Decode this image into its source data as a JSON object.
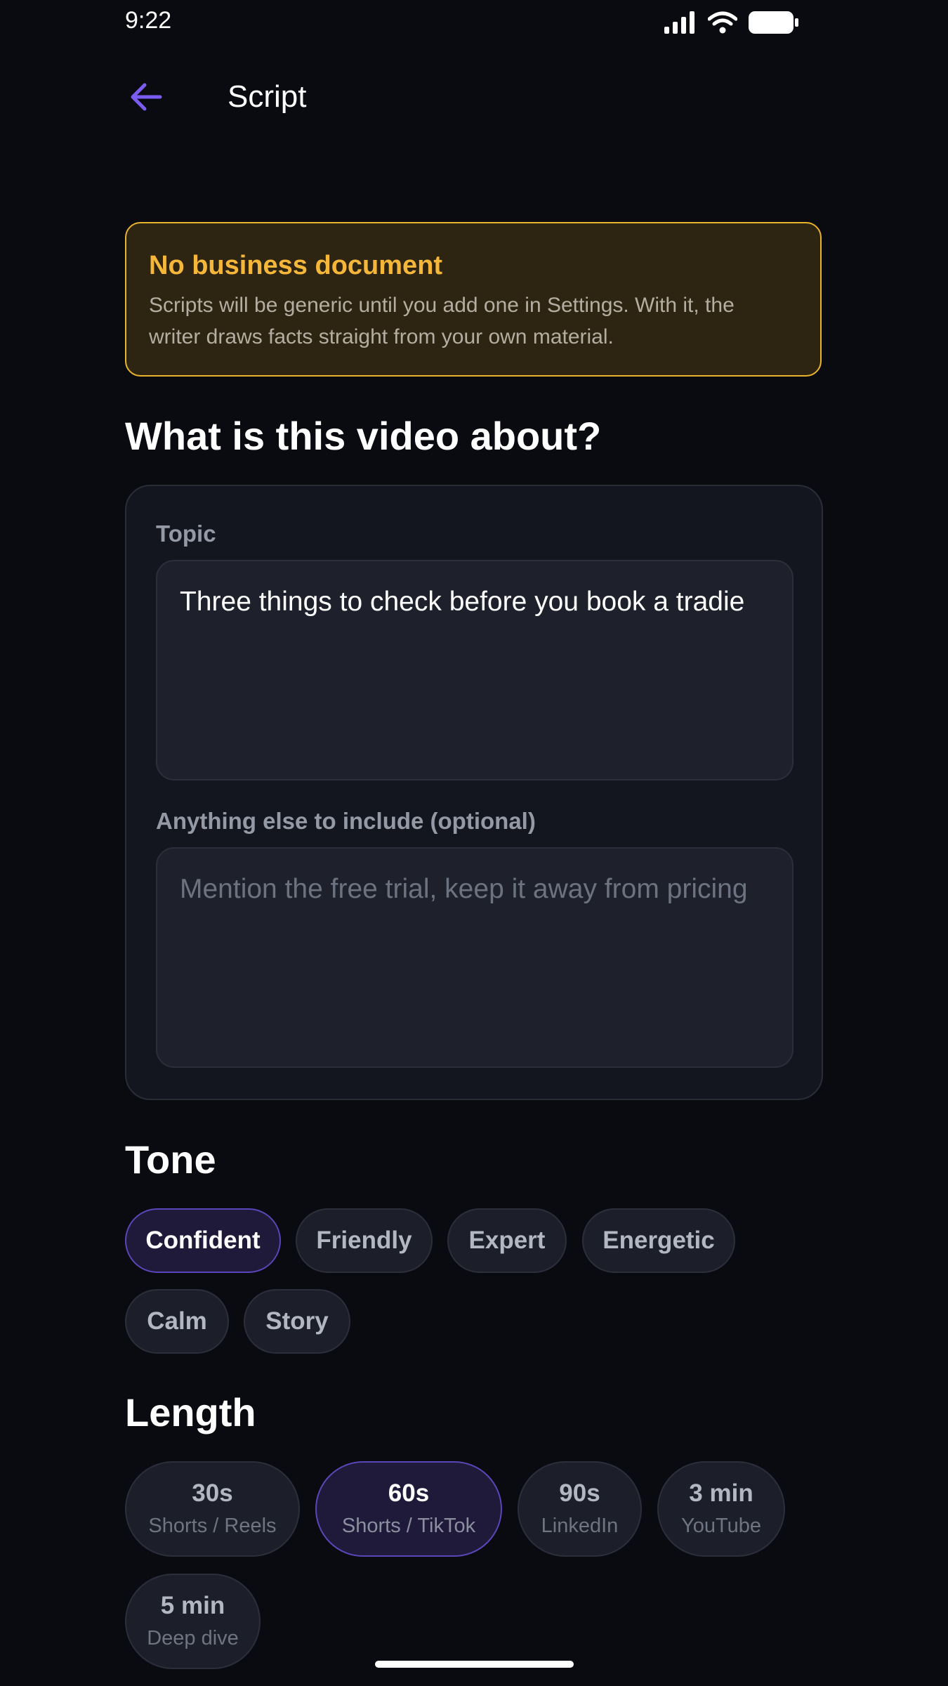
{
  "status_bar": {
    "time": "9:22"
  },
  "header": {
    "title": "Script",
    "back_icon": "arrow-left-icon",
    "accent_color": "#7b5cf0"
  },
  "warning": {
    "title": "No business document",
    "line1": "Scripts will be generic until you add one in Settings. With it, the",
    "line2": "writer draws facts straight from your own material.",
    "border_color": "#e8b42c",
    "title_color": "#f4b73a"
  },
  "about": {
    "heading": "What is this video about?",
    "topic_label": "Topic",
    "topic_value": "Three things to check before you book a tradie",
    "extra_label": "Anything else to include (optional)",
    "extra_placeholder": "Mention the free trial, keep it away from pricing"
  },
  "tone": {
    "heading": "Tone",
    "options": [
      "Confident",
      "Friendly",
      "Expert",
      "Energetic",
      "Calm",
      "Story"
    ],
    "selected": "Confident"
  },
  "length": {
    "heading": "Length",
    "options": [
      {
        "value": "30s",
        "sub": "Shorts / Reels"
      },
      {
        "value": "60s",
        "sub": "Shorts / TikTok"
      },
      {
        "value": "90s",
        "sub": "LinkedIn"
      },
      {
        "value": "3 min",
        "sub": "YouTube"
      },
      {
        "value": "5 min",
        "sub": "Deep dive"
      }
    ],
    "selected": "60s",
    "selected_color": "#5a46b8"
  }
}
